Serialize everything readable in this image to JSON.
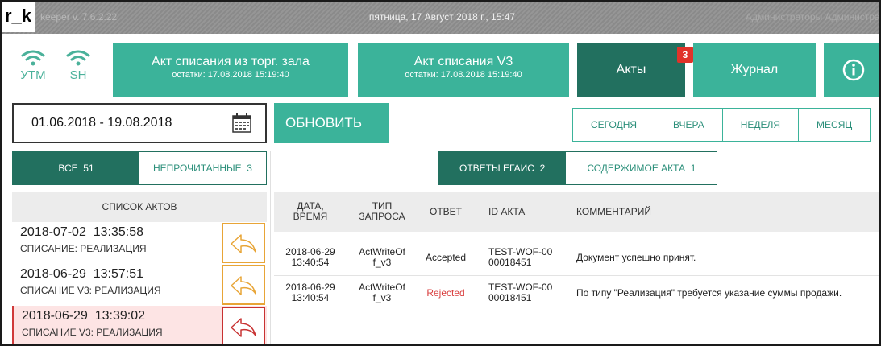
{
  "titlebar": {
    "logo": "r_k",
    "version": "keeper v. 7.6.2.22",
    "datetime": "пятница, 17 Август 2018 г., 15:47",
    "user": "Администраторы Администратор"
  },
  "signals": [
    {
      "label": "УТМ",
      "icon": "wifi-icon"
    },
    {
      "label": "SH",
      "icon": "wifi-icon"
    }
  ],
  "topnav": {
    "act_hall": {
      "title": "Акт списания из торг. зала",
      "subtitle": "остатки: 17.08.2018 15:19:40"
    },
    "act_v3": {
      "title": "Акт списания V3",
      "subtitle": "остатки: 17.08.2018 15:19:40"
    },
    "acts": {
      "label": "Акты",
      "badge": "3"
    },
    "journal": {
      "label": "Журнал"
    },
    "info": {
      "icon": "info-icon"
    }
  },
  "toolbar": {
    "date_range": "01.06.2018 - 19.08.2018",
    "refresh_label": "ОБНОВИТЬ",
    "periods": [
      "СЕГОДНЯ",
      "ВЧЕРА",
      "НЕДЕЛЯ",
      "МЕСЯЦ"
    ]
  },
  "left": {
    "tab_all": {
      "label": "ВСЕ",
      "count": "51"
    },
    "tab_unread": {
      "label": "НЕПРОЧИТАННЫЕ",
      "count": "3"
    },
    "list_header": "СПИСОК АКТОВ",
    "items": [
      {
        "date": "2018-07-02",
        "time": "13:35:58",
        "type": "СПИСАНИЕ: РЕАЛИЗАЦИЯ",
        "status": "pending"
      },
      {
        "date": "2018-06-29",
        "time": "13:57:51",
        "type": "СПИСАНИЕ V3: РЕАЛИЗАЦИЯ",
        "status": "pending"
      },
      {
        "date": "2018-06-29",
        "time": "13:39:02",
        "type": "СПИСАНИЕ V3: РЕАЛИЗАЦИЯ",
        "status": "rejected"
      }
    ]
  },
  "right": {
    "tab_egais": {
      "label": "ОТВЕТЫ ЕГАИС",
      "count": "2"
    },
    "tab_content": {
      "label": "СОДЕРЖИМОЕ АКТА",
      "count": "1"
    },
    "columns": {
      "datetime": [
        "ДАТА,",
        "ВРЕМЯ"
      ],
      "type": [
        "ТИП",
        "ЗАПРОСА"
      ],
      "answer": "ОТВЕТ",
      "act_id": "ID АКТА",
      "comment": "КОММЕНТАРИЙ"
    },
    "rows": [
      {
        "date": "2018-06-29",
        "time": "13:40:54",
        "type1": "ActWriteOf",
        "type2": "f_v3",
        "answer": "Accepted",
        "id1": "TEST-WOF-00",
        "id2": "00018451",
        "comment": "Документ успешно принят."
      },
      {
        "date": "2018-06-29",
        "time": "13:40:54",
        "type1": "ActWriteOf",
        "type2": "f_v3",
        "answer": "Rejected",
        "id1": "TEST-WOF-00",
        "id2": "00018451",
        "comment": "По типу \"Реализация\" требуется указание суммы продажи."
      }
    ]
  },
  "colors": {
    "teal": "#3bb39a",
    "dark_teal": "#22705f",
    "badge_red": "#e0332a",
    "reply_orange": "#e8a537",
    "reply_red": "#c83232",
    "rejected_text": "#d94040"
  }
}
